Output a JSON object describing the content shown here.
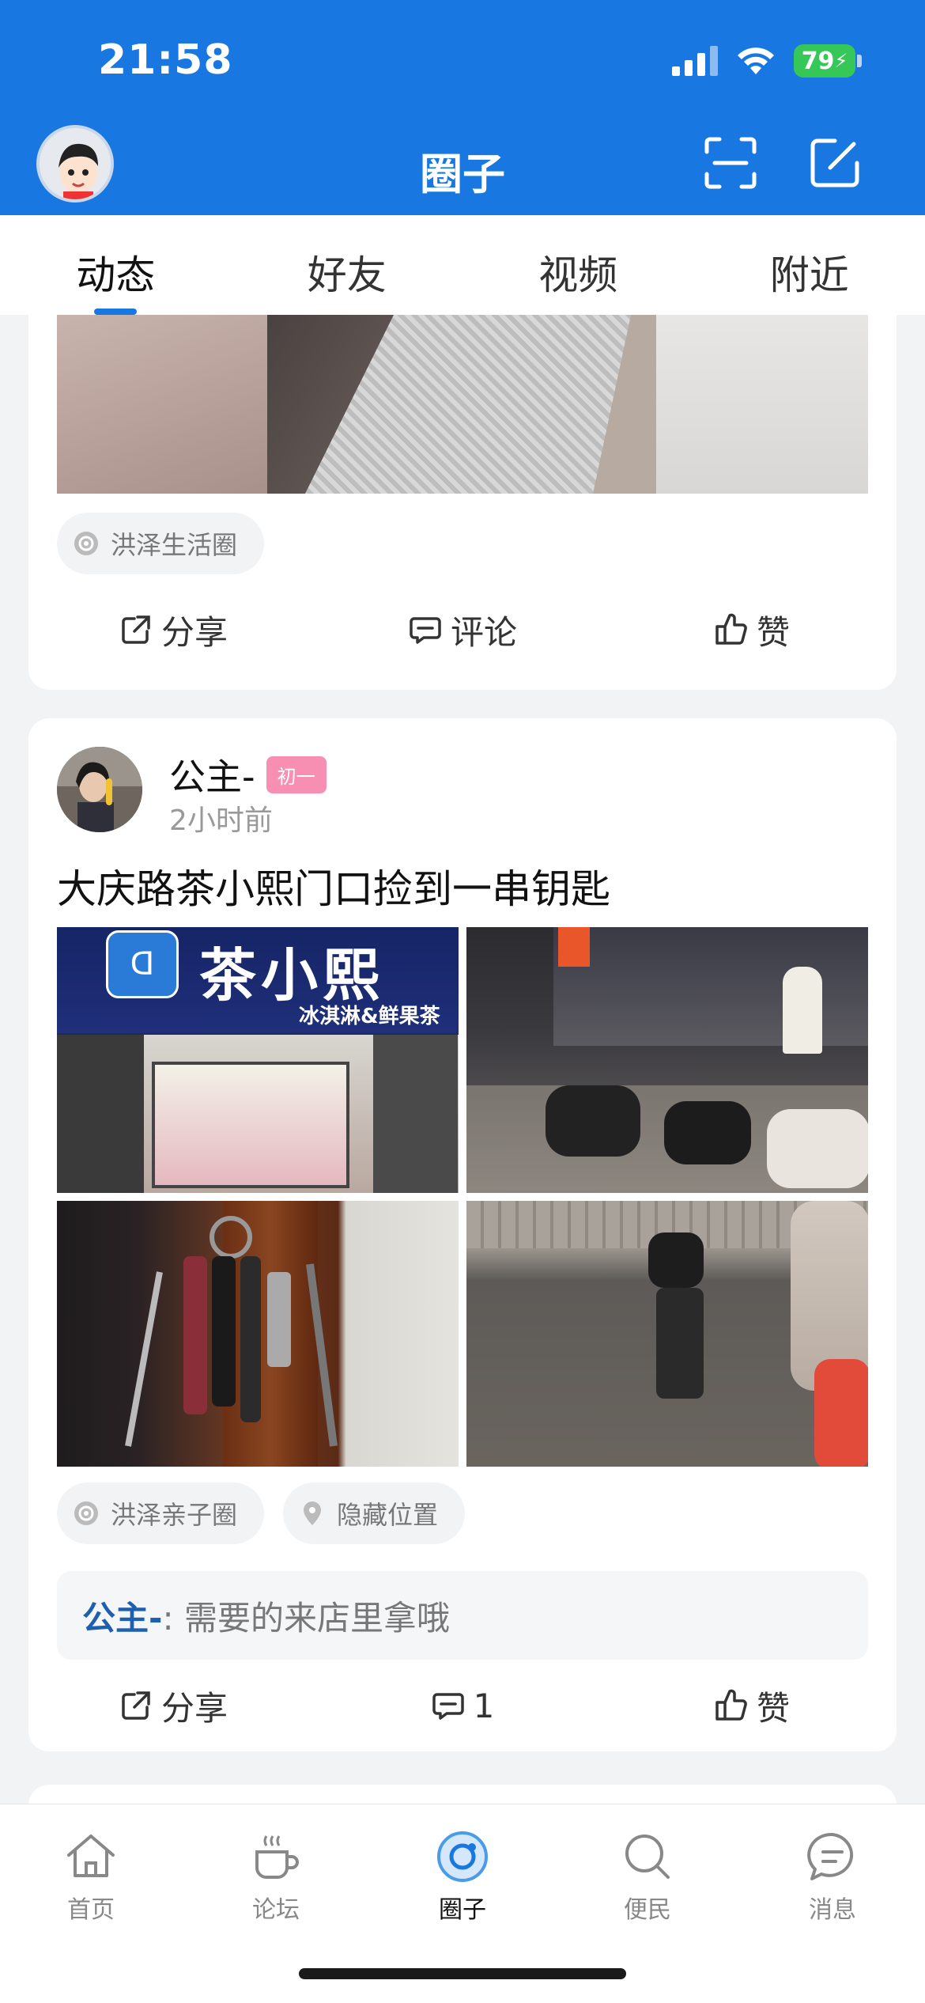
{
  "status_bar": {
    "time": "21:58",
    "battery": "79"
  },
  "nav": {
    "title": "圈子"
  },
  "tabs": [
    {
      "label": "动态",
      "active": true
    },
    {
      "label": "好友",
      "active": false
    },
    {
      "label": "视频",
      "active": false
    },
    {
      "label": "附近",
      "active": false
    }
  ],
  "post1": {
    "tag": "洪泽生活圈",
    "actions": {
      "share": "分享",
      "comment": "评论",
      "like": "赞"
    }
  },
  "post2": {
    "user": "公主-",
    "badge": "初一",
    "time": "2小时前",
    "title": "大庆路茶小熙门口捡到一串钥匙",
    "photo1_sign": "茶小熙",
    "photo1_sub": "冰淇淋&鲜果茶",
    "tags": [
      "洪泽亲子圈",
      "隐藏位置"
    ],
    "comment": {
      "user": "公主-",
      "text": ": 需要的来店里拿哦"
    },
    "actions": {
      "share": "分享",
      "comment_count": "1",
      "like": "赞"
    }
  },
  "tabbar": [
    {
      "label": "首页",
      "icon": "home-icon"
    },
    {
      "label": "论坛",
      "icon": "coffee-icon"
    },
    {
      "label": "圈子",
      "icon": "circle-icon",
      "active": true
    },
    {
      "label": "便民",
      "icon": "search-icon"
    },
    {
      "label": "消息",
      "icon": "message-icon"
    }
  ],
  "colors": {
    "brand": "#1877e0",
    "badge": "#f78fb3",
    "comment_user": "#1e5fb0"
  }
}
